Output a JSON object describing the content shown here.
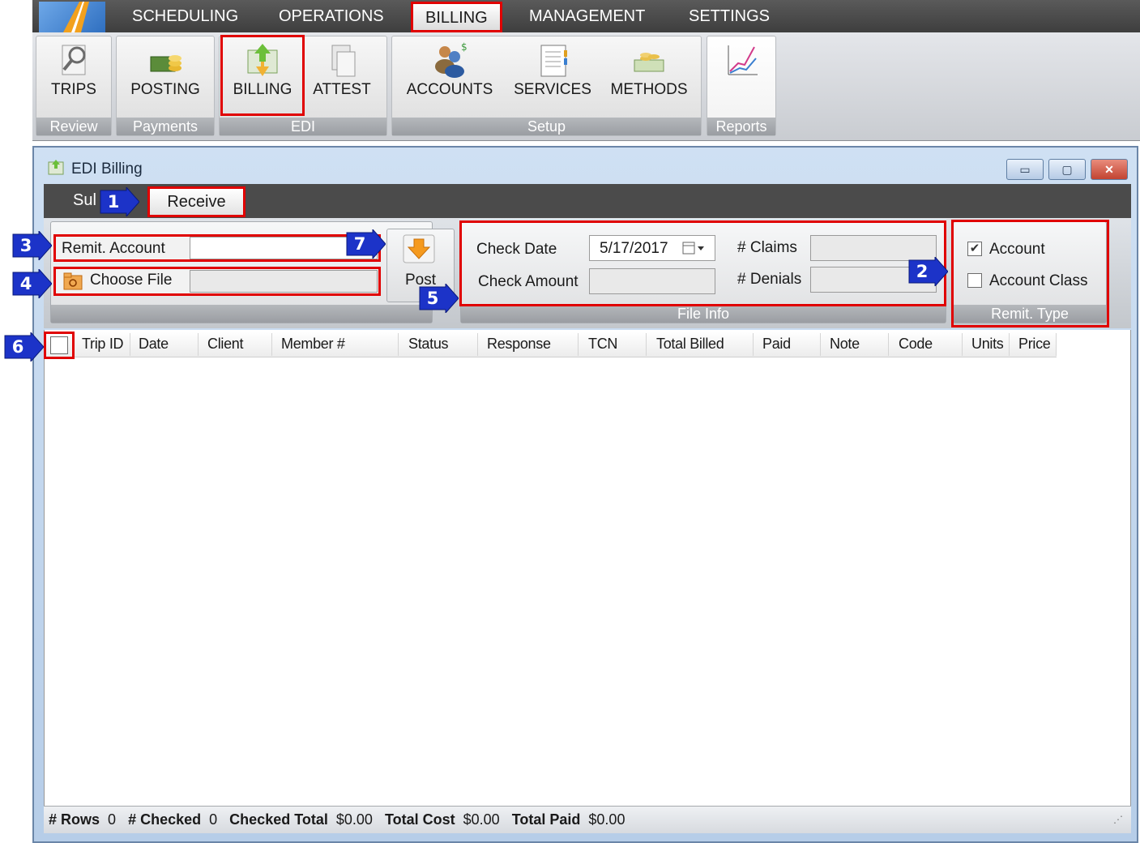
{
  "menu": {
    "items": [
      {
        "label": "SCHEDULING"
      },
      {
        "label": "OPERATIONS"
      },
      {
        "label": "BILLING"
      },
      {
        "label": "MANAGEMENT"
      },
      {
        "label": "SETTINGS"
      }
    ],
    "active": "BILLING"
  },
  "ribbon": {
    "trips": "TRIPS",
    "posting": "POSTING",
    "billing": "BILLING",
    "attest": "ATTEST",
    "accounts": "ACCOUNTS",
    "services": "SERVICES",
    "methods": "METHODS",
    "groups": {
      "review": "Review",
      "payments": "Payments",
      "edi": "EDI",
      "setup": "Setup",
      "reports": "Reports"
    }
  },
  "window": {
    "title": "EDI Billing",
    "minimize": "▭",
    "maximize": "▢",
    "close": "✕"
  },
  "tabs": {
    "submit_visible": "Sul",
    "receive": "Receive"
  },
  "remit": {
    "account_label": "Remit. Account",
    "account_value": "",
    "choose_file_label": "Choose File",
    "file_value": "",
    "post_label": "Post"
  },
  "file_info": {
    "group_label": "File Info",
    "check_date_label": "Check Date",
    "check_date_value": "5/17/2017",
    "check_amount_label": "Check Amount",
    "check_amount_value": "",
    "claims_label": "# Claims",
    "claims_value": "",
    "denials_label": "# Denials",
    "denials_value": ""
  },
  "remit_type": {
    "group_label": "Remit. Type",
    "account_label": "Account",
    "account_checked": true,
    "account_class_label": "Account Class",
    "account_class_checked": false
  },
  "grid": {
    "columns": [
      "Trip ID",
      "Date",
      "Client",
      "Member #",
      "Status",
      "Response",
      "TCN",
      "Total Billed",
      "Paid",
      "Note",
      "Code",
      "Units",
      "Price"
    ],
    "rows": []
  },
  "status": {
    "rows_label": "# Rows",
    "rows_value": "0",
    "checked_label": "# Checked",
    "checked_value": "0",
    "checked_total_label": "Checked Total",
    "checked_total_value": "$0.00",
    "total_cost_label": "Total Cost",
    "total_cost_value": "$0.00",
    "total_paid_label": "Total Paid",
    "total_paid_value": "$0.00"
  },
  "markers": [
    "1",
    "2",
    "3",
    "4",
    "5",
    "6",
    "7"
  ],
  "colors": {
    "highlight": "#e00000",
    "marker": "#1c33c8",
    "menu_bg": "#4a4a4a"
  }
}
